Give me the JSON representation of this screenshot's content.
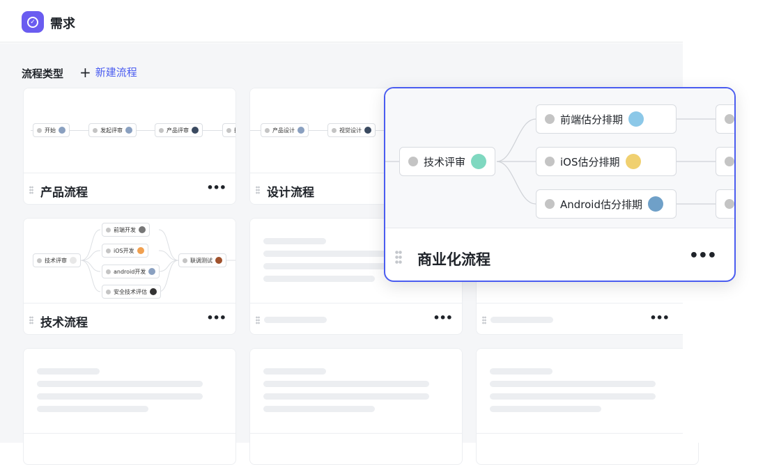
{
  "header": {
    "title": "需求",
    "logo_icon": "check-circle-icon"
  },
  "section": {
    "title": "流程类型",
    "new_button": "新建流程"
  },
  "cards": [
    {
      "name": "产品流程",
      "nodes": [
        "开始",
        "发起评审",
        "产品评审",
        "技"
      ]
    },
    {
      "name": "设计流程",
      "nodes": [
        "产品设计",
        "视觉设计"
      ]
    },
    {
      "name": "技术流程",
      "nodes": [
        "技术评审",
        "前端开发",
        "iOS开发",
        "android开发",
        "安全技术评估",
        "联调测试"
      ]
    }
  ],
  "featured": {
    "name": "商业化流程",
    "nodes": [
      "技术评审",
      "前端估分排期",
      "iOS估分排期",
      "Android估分排期"
    ]
  },
  "more_label": "•••"
}
